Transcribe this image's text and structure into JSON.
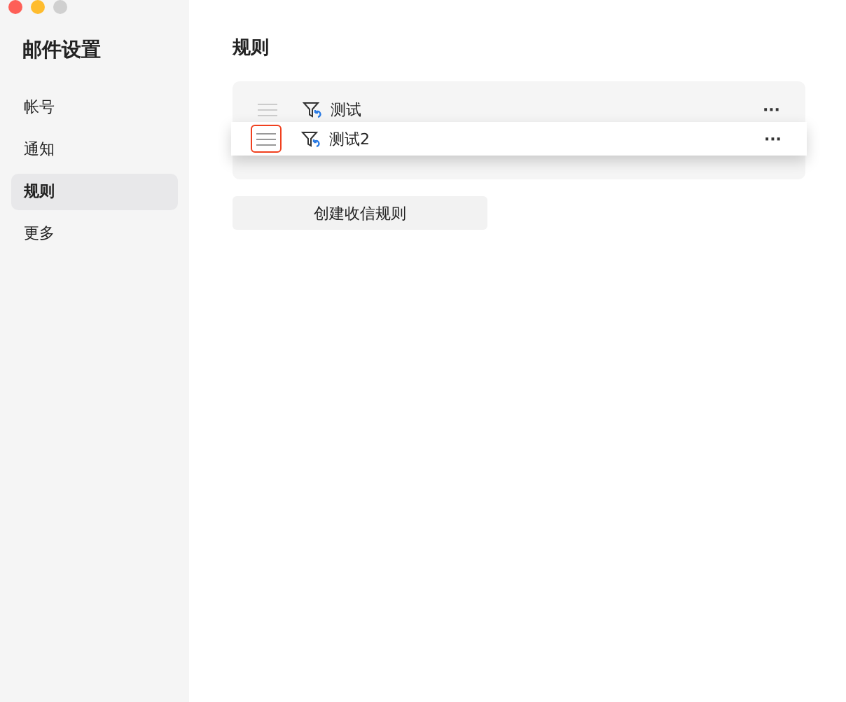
{
  "window": {
    "controls": [
      {
        "color": "#fe5f57"
      },
      {
        "color": "#febc2e"
      },
      {
        "color": "#d0d0d0"
      }
    ]
  },
  "sidebar": {
    "title": "邮件设置",
    "items": [
      {
        "label": "帐号",
        "selected": false
      },
      {
        "label": "通知",
        "selected": false
      },
      {
        "label": "规则",
        "selected": true
      },
      {
        "label": "更多",
        "selected": false
      }
    ]
  },
  "page": {
    "title": "规则"
  },
  "rules": [
    {
      "name": "测试",
      "more": "···",
      "dragging": false
    },
    {
      "name": "测试2",
      "more": "···",
      "dragging": true
    }
  ],
  "create_button": "创建收信规则"
}
